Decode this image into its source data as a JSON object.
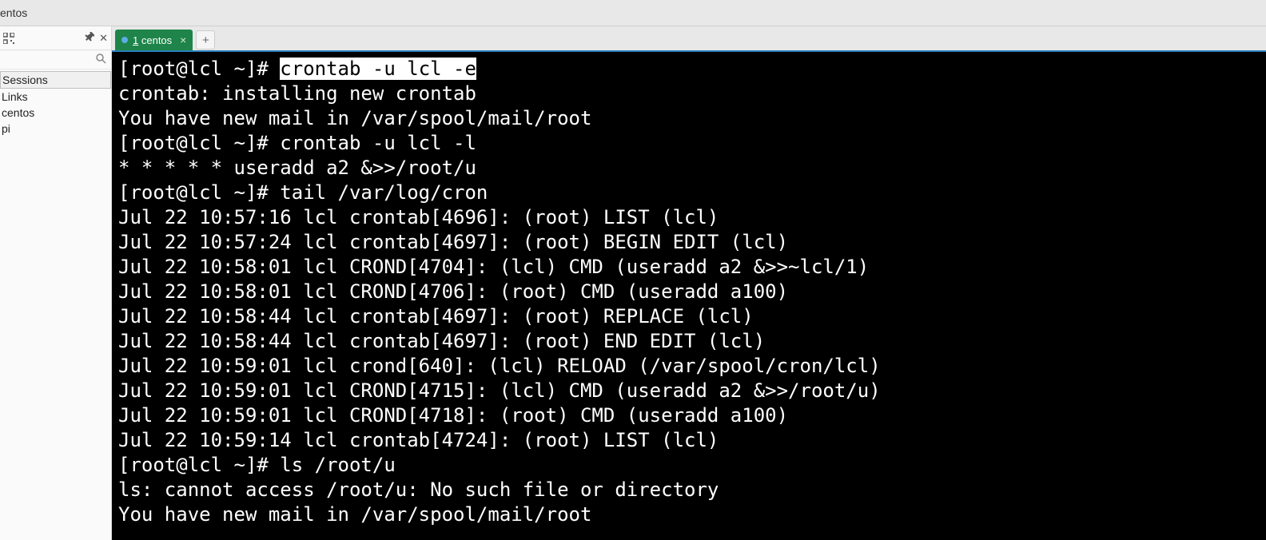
{
  "window": {
    "title_fragment": "entos"
  },
  "sidebar": {
    "items": [
      {
        "label": "Sessions",
        "selected": true
      },
      {
        "label": "Links",
        "selected": false
      },
      {
        "label": "centos",
        "selected": false
      },
      {
        "label": "pi",
        "selected": false
      }
    ]
  },
  "tabs": {
    "active": {
      "number": "1",
      "label": "centos"
    }
  },
  "terminal": {
    "prompt1": "[root@lcl ~]# ",
    "cmd1_highlighted": "crontab -u lcl -e",
    "line2": "crontab: installing new crontab",
    "line3": "You have new mail in /var/spool/mail/root",
    "line4": "[root@lcl ~]# crontab -u lcl -l",
    "line5": "* * * * * useradd a2 &>>/root/u",
    "line6": "[root@lcl ~]# tail /var/log/cron",
    "line7": "Jul 22 10:57:16 lcl crontab[4696]: (root) LIST (lcl)",
    "line8": "Jul 22 10:57:24 lcl crontab[4697]: (root) BEGIN EDIT (lcl)",
    "line9": "Jul 22 10:58:01 lcl CROND[4704]: (lcl) CMD (useradd a2 &>>~lcl/1)",
    "line10": "Jul 22 10:58:01 lcl CROND[4706]: (root) CMD (useradd a100)",
    "line11": "Jul 22 10:58:44 lcl crontab[4697]: (root) REPLACE (lcl)",
    "line12": "Jul 22 10:58:44 lcl crontab[4697]: (root) END EDIT (lcl)",
    "line13": "Jul 22 10:59:01 lcl crond[640]: (lcl) RELOAD (/var/spool/cron/lcl)",
    "line14": "Jul 22 10:59:01 lcl CROND[4715]: (lcl) CMD (useradd a2 &>>/root/u)",
    "line15": "Jul 22 10:59:01 lcl CROND[4718]: (root) CMD (useradd a100)",
    "line16": "Jul 22 10:59:14 lcl crontab[4724]: (root) LIST (lcl)",
    "line17": "[root@lcl ~]# ls /root/u",
    "line18": "ls: cannot access /root/u: No such file or directory",
    "line19": "You have new mail in /var/spool/mail/root"
  }
}
